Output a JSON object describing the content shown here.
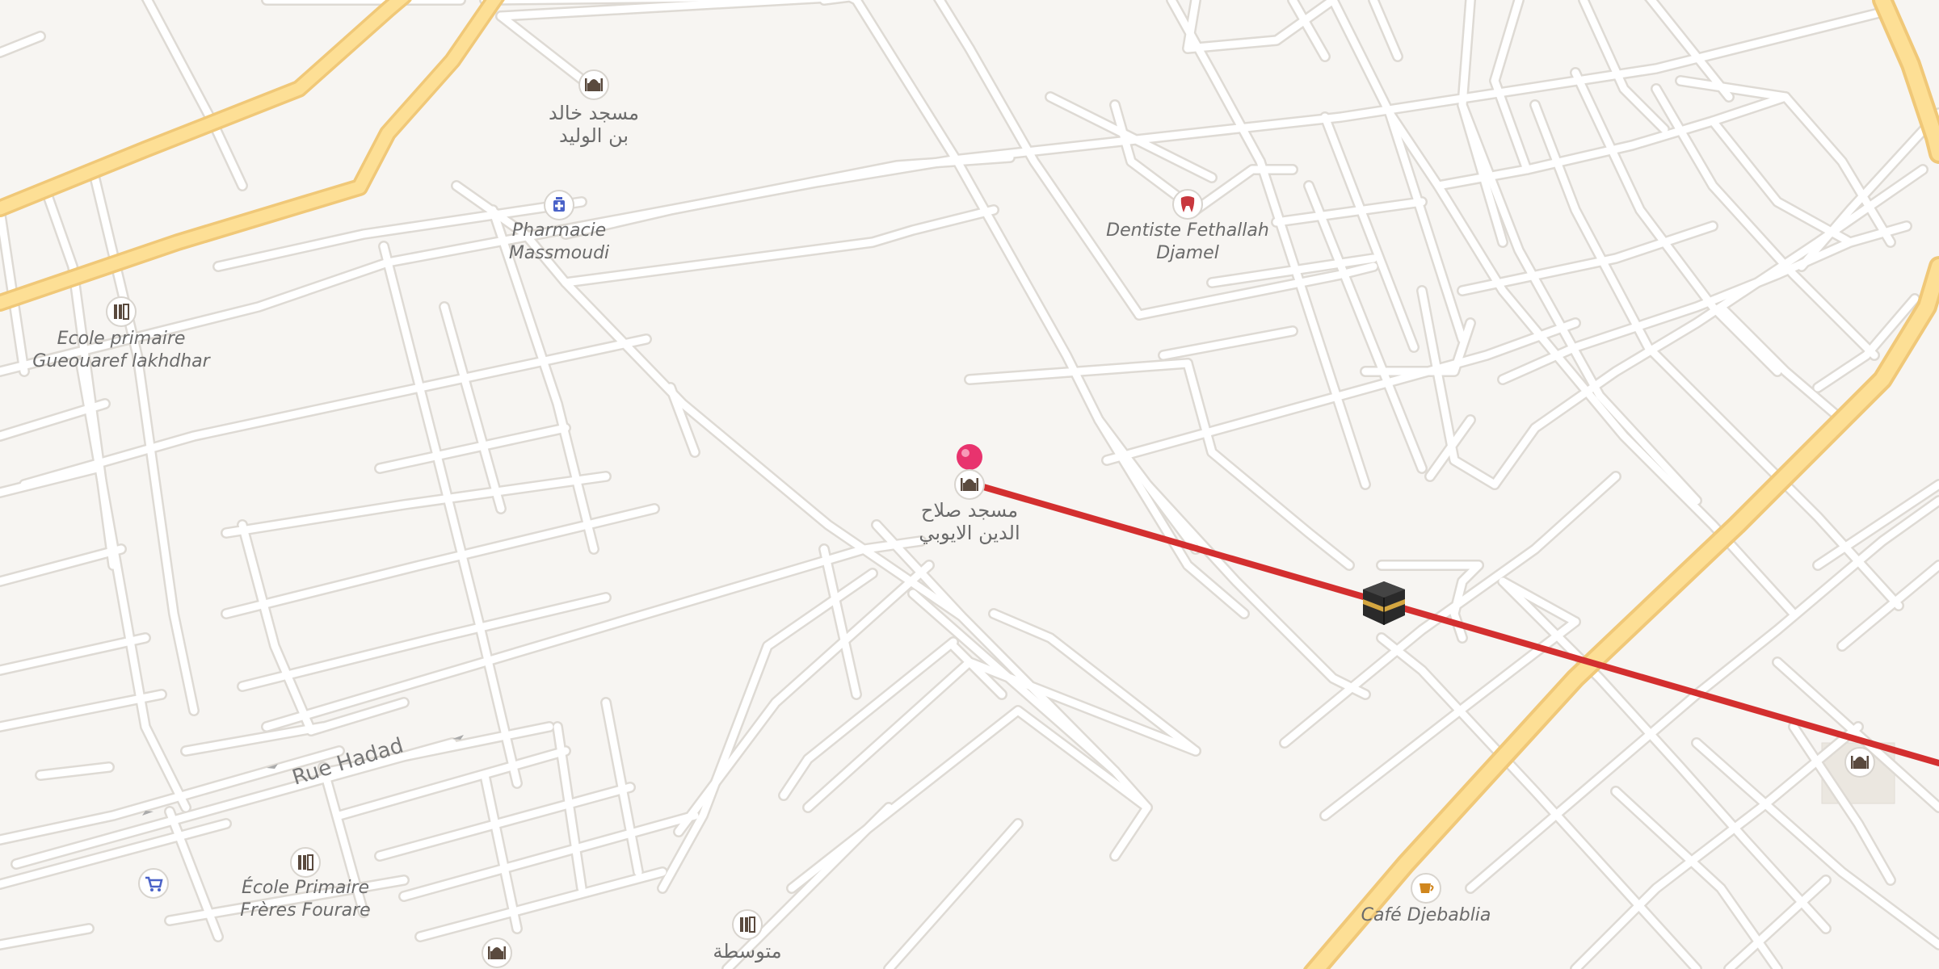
{
  "map": {
    "streets": [
      {
        "name": "Rue Hadad"
      }
    ],
    "pois": [
      {
        "id": "mosque-khalid",
        "icon": "mosque-icon",
        "label_lines": [
          "مسجد خالد",
          "بن الوليد"
        ]
      },
      {
        "id": "pharmacie-massmoudi",
        "icon": "pharmacy-icon",
        "label_lines": [
          "Pharmacie",
          "Massmoudi"
        ]
      },
      {
        "id": "dentiste-fethallah",
        "icon": "tooth-icon",
        "label_lines": [
          "Dentiste Fethallah",
          "Djamel"
        ]
      },
      {
        "id": "ecole-gueouaref",
        "icon": "school-icon",
        "label_lines": [
          "Ecole primaire",
          "Gueouaref lakhdhar"
        ]
      },
      {
        "id": "mosque-salah",
        "icon": "mosque-icon",
        "label_lines": [
          "مسجد صلاح",
          "الدين الايوبي"
        ]
      },
      {
        "id": "ecole-fourare",
        "icon": "school-icon",
        "label_lines": [
          "École Primaire",
          "Frères Fourare"
        ]
      },
      {
        "id": "cafe-djebablia",
        "icon": "cafe-icon",
        "label_lines": [
          "Café Djebablia"
        ]
      },
      {
        "id": "school-mutawassita",
        "icon": "school-icon",
        "label_lines": [
          "متوسطة"
        ]
      },
      {
        "id": "shop",
        "icon": "shopping-cart-icon",
        "label_lines": []
      },
      {
        "id": "mosque-bottom-left",
        "icon": "mosque-icon",
        "label_lines": []
      },
      {
        "id": "mosque-right",
        "icon": "mosque-icon",
        "label_lines": []
      }
    ],
    "markers": {
      "location_pin": {
        "icon": "map-pin-icon",
        "color": "#e8336e"
      },
      "kaaba": {
        "icon": "kaaba-icon"
      },
      "qibla_line": {
        "color": "#d32f2f"
      }
    },
    "colors": {
      "background": "#f7f5f2",
      "road": "#ffffff",
      "road_casing": "#e2dfda",
      "main_road": "#fddf95",
      "main_road_casing": "#f0c878",
      "block_building": "#ebe7e0"
    }
  }
}
